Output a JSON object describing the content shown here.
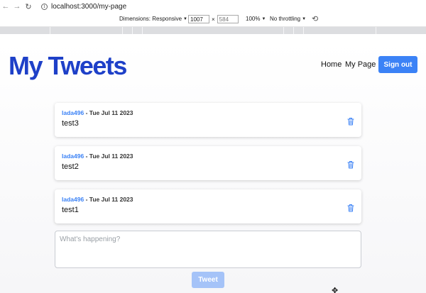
{
  "browser": {
    "back_icon": "←",
    "forward_icon": "→",
    "reload_icon": "↻",
    "info_icon": "i",
    "url": "localhost:3000/my-page"
  },
  "device_toolbar": {
    "dimensions_label": "Dimensions: Responsive",
    "width_value": "1007",
    "height_value": "584",
    "times_sign": "×",
    "zoom_label": "100%",
    "throttling_label": "No throttling",
    "caret": "▼",
    "rotate_icon": "⟲"
  },
  "header": {
    "brand": "My Tweets",
    "nav": {
      "home": "Home",
      "my_page": "My Page",
      "sign_out": "Sign out"
    }
  },
  "tweets": [
    {
      "user": "lada496",
      "separator": " - ",
      "date": "Tue Jul 11 2023",
      "text": "test3"
    },
    {
      "user": "lada496",
      "separator": " - ",
      "date": "Tue Jul 11 2023",
      "text": "test2"
    },
    {
      "user": "lada496",
      "separator": " - ",
      "date": "Tue Jul 11 2023",
      "text": "test1"
    }
  ],
  "compose": {
    "placeholder": "What's happening?",
    "value": "",
    "submit_label": "Tweet"
  },
  "cursor_icon": "✥",
  "colors": {
    "brand": "#1e40c8",
    "accent": "#3b82f6",
    "button_disabled": "#a5c3f8"
  }
}
